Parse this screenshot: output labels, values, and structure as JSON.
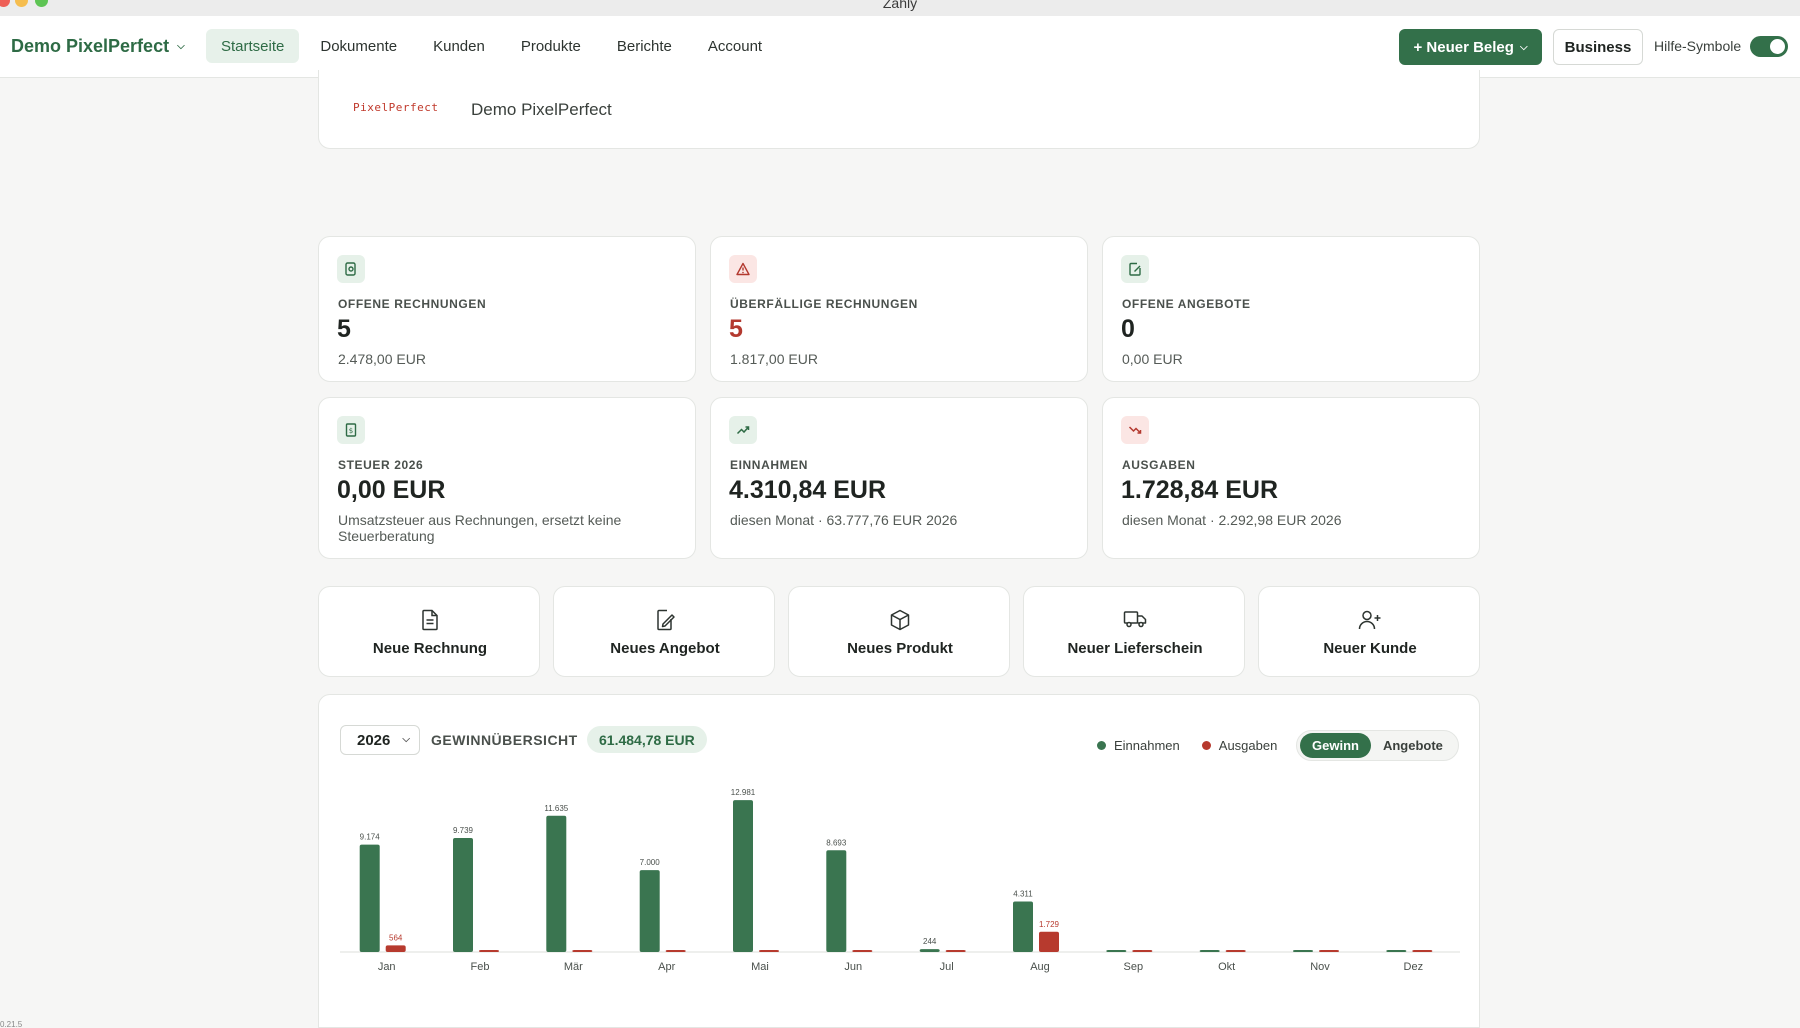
{
  "window": {
    "title": "Zahly"
  },
  "nav": {
    "brand": "Demo PixelPerfect",
    "items": [
      "Startseite",
      "Dokumente",
      "Kunden",
      "Produkte",
      "Berichte",
      "Account"
    ],
    "new_doc": "+ Neuer Beleg",
    "plan": "Business",
    "help_label": "Hilfe-Symbole"
  },
  "company": {
    "logo_text": "PixelPerfect",
    "name": "Demo PixelPerfect"
  },
  "stats": [
    {
      "icon": "invoice-search-icon",
      "label": "OFFENE RECHNUNGEN",
      "value": "5",
      "sub": "2.478,00 EUR"
    },
    {
      "icon": "warning-triangle-icon",
      "label": "ÜBERFÄLLIGE RECHNUNGEN",
      "value": "5",
      "sub": "1.817,00 EUR"
    },
    {
      "icon": "edit-document-icon",
      "label": "OFFENE ANGEBOTE",
      "value": "0",
      "sub": "0,00 EUR"
    },
    {
      "icon": "tax-receipt-icon",
      "label": "STEUER 2026",
      "value": "0,00 EUR",
      "sub": "Umsatzsteuer aus Rechnungen, ersetzt keine Steuerberatung"
    },
    {
      "icon": "trend-up-icon",
      "label": "EINNAHMEN",
      "value": "4.310,84 EUR",
      "sub": "diesen Monat · 63.777,76 EUR 2026"
    },
    {
      "icon": "trend-down-icon",
      "label": "AUSGABEN",
      "value": "1.728,84 EUR",
      "sub": "diesen Monat · 2.292,98 EUR 2026"
    }
  ],
  "quick_actions": [
    "Neue Rechnung",
    "Neues Angebot",
    "Neues Produkt",
    "Neuer Lieferschein",
    "Neuer Kunde"
  ],
  "overview": {
    "year": "2026",
    "title": "GEWINNÜBERSICHT",
    "total": "61.484,78 EUR",
    "legend": [
      "Einnahmen",
      "Ausgaben"
    ],
    "modes": [
      "Gewinn",
      "Angebote"
    ],
    "active_mode": "Gewinn"
  },
  "colors": {
    "income": "#3a7550",
    "expense": "#b73a2e",
    "accent": "#33704a"
  },
  "chart_data": {
    "type": "bar",
    "categories": [
      "Jan",
      "Feb",
      "Mär",
      "Apr",
      "Mai",
      "Jun",
      "Jul",
      "Aug",
      "Sep",
      "Okt",
      "Nov",
      "Dez"
    ],
    "series": [
      {
        "name": "Einnahmen",
        "values": [
          9174,
          9739,
          11635,
          7000,
          12981,
          8693,
          244,
          4311,
          0,
          0,
          0,
          0
        ],
        "labels": [
          "9.174",
          "9.739",
          "11.635",
          "7.000",
          "12.981",
          "8.693",
          "244",
          "4.311",
          "",
          "",
          "",
          ""
        ]
      },
      {
        "name": "Ausgaben",
        "values": [
          564,
          0,
          0,
          0,
          0,
          0,
          0,
          1729,
          0,
          0,
          0,
          0
        ],
        "labels": [
          "564",
          "",
          "",
          "",
          "",
          "",
          "",
          "1.729",
          "",
          "",
          "",
          ""
        ]
      }
    ],
    "ylim": [
      0,
      13500
    ]
  },
  "footer": {
    "version": "0.21.5"
  }
}
